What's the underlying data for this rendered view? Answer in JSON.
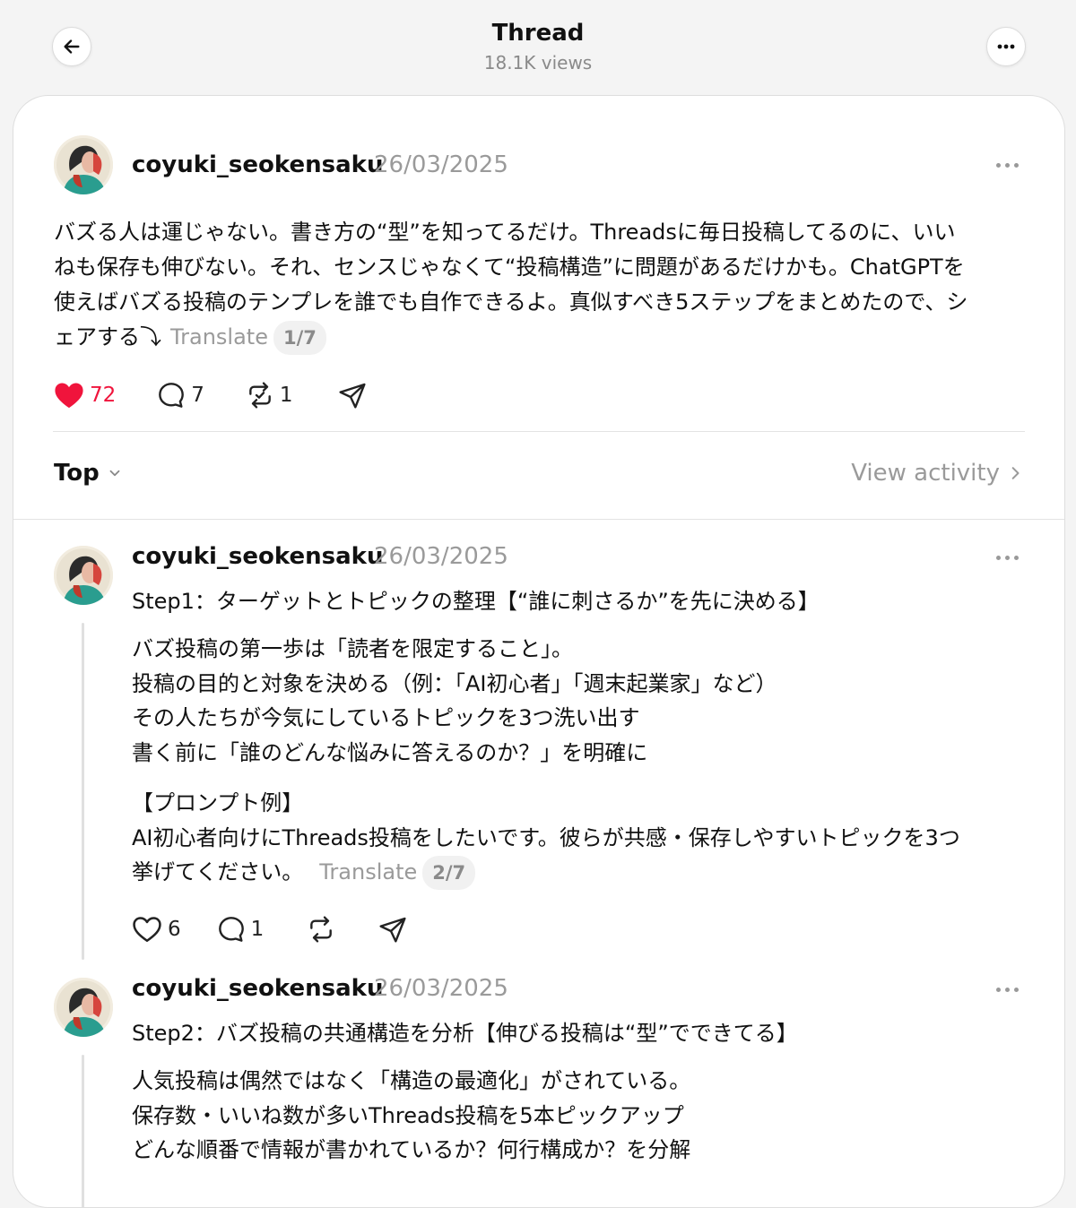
{
  "header": {
    "title": "Thread",
    "views": "18.1K views"
  },
  "main_post": {
    "username": "coyuki_seokensaku",
    "date": "26/03/2025",
    "text_lines": [
      "バズる人は運じゃない。書き方の“型”を知ってるだけ。Threadsに毎日投稿してるのに、いい",
      "ねも保存も伸びない。それ、センスじゃなくて“投稿構造”に問題があるだけかも。ChatGPTを",
      "使えばバズる投稿のテンプレを誰でも自作できるよ。真似すべき5ステップをまとめたので、シ",
      "ェアする⤵︎"
    ],
    "translate_label": "Translate",
    "pager": "1/7",
    "likes": "72",
    "comments": "7",
    "reposts": "1"
  },
  "sort": {
    "label": "Top",
    "view_activity": "View activity"
  },
  "replies": [
    {
      "username": "coyuki_seokensaku",
      "date": "26/03/2025",
      "title": "Step1：ターゲットとトピックの整理【“誰に刺さるか”を先に決める】",
      "para1": [
        "バズ投稿の第一歩は「読者を限定すること」。",
        "投稿の目的と対象を決める（例：「AI初心者」「週末起業家」など）",
        "その人たちが今気にしているトピックを3つ洗い出す",
        "書く前に「誰のどんな悩みに答えるのか？」を明確に"
      ],
      "para2": [
        "【プロンプト例】",
        "AI初心者向けにThreads投稿をしたいです。彼らが共感・保存しやすいトピックを3つ",
        "挙げてください。"
      ],
      "translate_label": "Translate",
      "pager": "2/7",
      "likes": "6",
      "comments": "1"
    },
    {
      "username": "coyuki_seokensaku",
      "date": "26/03/2025",
      "title": "Step2：バズ投稿の共通構造を分析【伸びる投稿は“型”でできてる】",
      "para1": [
        "人気投稿は偶然ではなく「構造の最適化」がされている。",
        "保存数・いいね数が多いThreads投稿を5本ピックアップ",
        "どんな順番で情報が書かれているか？何行構成か？を分解"
      ]
    }
  ],
  "colors": {
    "like_red": "#f0143c",
    "muted_text": "#9a9a9a",
    "background": "#f4f4f4"
  },
  "icons": [
    "back-arrow-icon",
    "more-icon",
    "heart-icon",
    "comment-icon",
    "repost-icon",
    "share-icon",
    "chevron-down-icon",
    "chevron-right-icon"
  ]
}
